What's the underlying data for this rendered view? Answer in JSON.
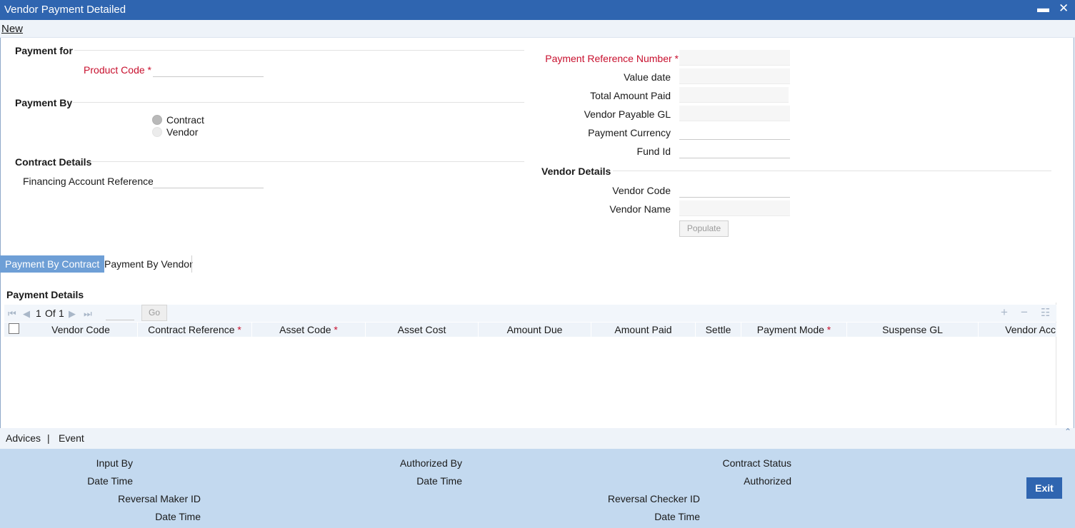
{
  "window": {
    "title": "Vendor Payment Detailed",
    "minimize_icon": "minimize-icon",
    "close_icon": "close-icon"
  },
  "toolbar": {
    "new_label": "New"
  },
  "payment_for": {
    "section_title": "Payment for",
    "product_code_label": "Product Code",
    "product_code_value": ""
  },
  "payment_by": {
    "section_title": "Payment By",
    "options": [
      {
        "label": "Contract",
        "selected": true
      },
      {
        "label": "Vendor",
        "selected": false
      }
    ]
  },
  "contract_details": {
    "section_title": "Contract Details",
    "financing_account_reference_label": "Financing Account Reference",
    "financing_account_reference_value": ""
  },
  "payment_header": {
    "payment_reference_number_label": "Payment Reference Number",
    "value_date_label": "Value date",
    "total_amount_paid_label": "Total Amount Paid",
    "vendor_payable_gl_label": "Vendor Payable GL",
    "payment_currency_label": "Payment Currency",
    "fund_id_label": "Fund Id"
  },
  "vendor_details": {
    "section_title": "Vendor Details",
    "vendor_code_label": "Vendor Code",
    "vendor_name_label": "Vendor Name",
    "populate_label": "Populate"
  },
  "tabs": [
    {
      "label": "Payment By Contract",
      "active": true
    },
    {
      "label": "Payment By Vendor",
      "active": false
    }
  ],
  "payment_details": {
    "section_title": "Payment Details",
    "pager": {
      "current": "1",
      "of_label": "Of",
      "total": "1",
      "go_label": "Go"
    },
    "columns": [
      "Vendor Code",
      "Contract Reference",
      "Asset Code",
      "Asset Cost",
      "Amount Due",
      "Amount Paid",
      "Settle",
      "Payment Mode",
      "Suspense GL",
      "Vendor Acc"
    ],
    "required_columns": [
      "Contract Reference",
      "Asset Code",
      "Payment Mode"
    ],
    "rows": []
  },
  "footer_links": {
    "advices": "Advices",
    "separator": "|",
    "event": "Event"
  },
  "audit": {
    "input_by": "Input By",
    "date_time_1": "Date Time",
    "reversal_maker_id": "Reversal Maker ID",
    "date_time_2": "Date Time",
    "authorized_by": "Authorized By",
    "date_time_3": "Date Time",
    "reversal_checker_id": "Reversal Checker ID",
    "date_time_4": "Date Time",
    "contract_status": "Contract Status",
    "authorized": "Authorized"
  },
  "exit_label": "Exit",
  "colors": {
    "title_bar": "#2f65b0",
    "required": "#c8102e",
    "active_tab": "#6e9fd6",
    "footer": "#c3d9ef"
  }
}
